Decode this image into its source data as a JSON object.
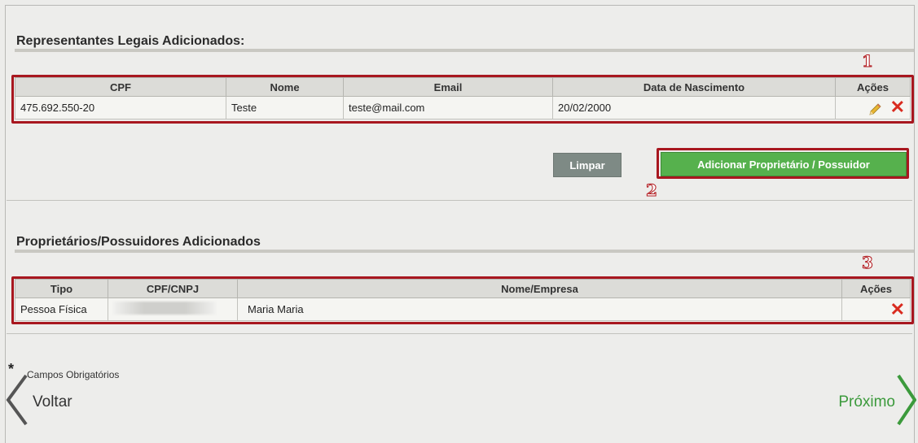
{
  "representatives": {
    "title": "Representantes Legais Adicionados:",
    "marker": "1",
    "columns": [
      "CPF",
      "Nome",
      "Email",
      "Data de Nascimento",
      "Ações"
    ],
    "rows": [
      {
        "cpf": "475.692.550-20",
        "nome": "Teste",
        "email": "teste@mail.com",
        "nascimento": "20/02/2000"
      }
    ]
  },
  "buttons": {
    "clear_label": "Limpar",
    "add_label": "Adicionar Proprietário / Possuidor",
    "marker": "2"
  },
  "owners": {
    "title": "Proprietários/Possuidores Adicionados",
    "marker": "3",
    "columns": [
      "Tipo",
      "CPF/CNPJ",
      "Nome/Empresa",
      "Ações"
    ],
    "rows": [
      {
        "tipo": "Pessoa Física",
        "cpf_cnpj": "",
        "nome": "Maria Maria"
      }
    ]
  },
  "footer": {
    "required_star": "*",
    "required_label": "Campos Obrigatórios",
    "back_label": "Voltar",
    "next_label": "Próximo"
  },
  "colors": {
    "accent_green": "#56b14d",
    "delete_red": "#d92b1f",
    "highlight_red": "#a8171f"
  },
  "icons": [
    "edit-pencil-icon",
    "delete-x-icon",
    "chevron-left-icon",
    "chevron-right-icon"
  ]
}
